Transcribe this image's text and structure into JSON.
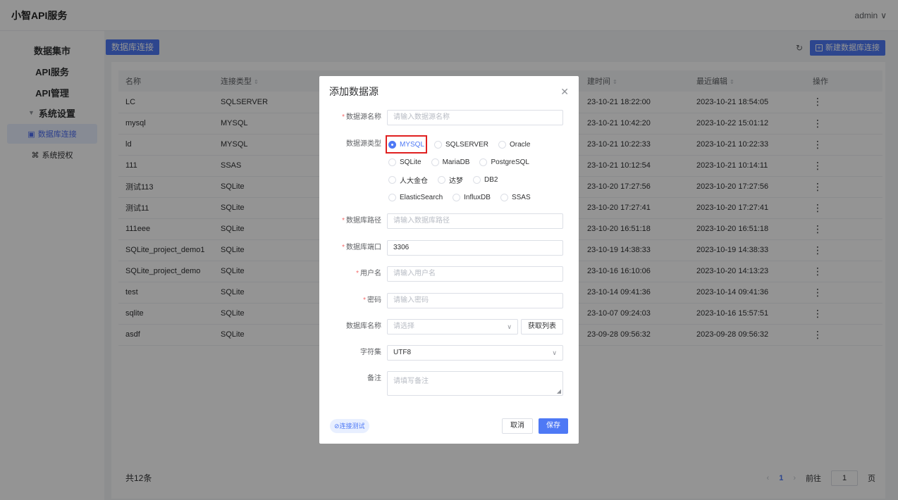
{
  "header": {
    "brand": "小智API服务",
    "user": "admin"
  },
  "sidebar": {
    "items": [
      {
        "label": "数据集市"
      },
      {
        "label": "API服务"
      },
      {
        "label": "API管理"
      }
    ],
    "group": {
      "label": "系统设置",
      "caret": "▼"
    },
    "sub_items": [
      {
        "label": "数据库连接",
        "icon": "▣",
        "active": true
      },
      {
        "label": "系统授权",
        "icon": "⌘",
        "active": false
      }
    ]
  },
  "main": {
    "title_tag": "数据库连接",
    "refresh_icon": "↻",
    "new_button": "新建数据库连接",
    "columns": [
      "名称",
      "连接类型",
      "建时间",
      "最近编辑",
      "操作"
    ],
    "rows": [
      {
        "name": "LC",
        "type": "SQLSERVER",
        "created": "23-10-21 18:22:00",
        "edited": "2023-10-21 18:54:05"
      },
      {
        "name": "mysql",
        "type": "MYSQL",
        "created": "23-10-21 10:42:20",
        "edited": "2023-10-22 15:01:12"
      },
      {
        "name": "ld",
        "type": "MYSQL",
        "created": "23-10-21 10:22:33",
        "edited": "2023-10-21 10:22:33"
      },
      {
        "name": "111",
        "type": "SSAS",
        "created": "23-10-21 10:12:54",
        "edited": "2023-10-21 10:14:11"
      },
      {
        "name": "测试113",
        "type": "SQLite",
        "created": "23-10-20 17:27:56",
        "edited": "2023-10-20 17:27:56"
      },
      {
        "name": "测试11",
        "type": "SQLite",
        "created": "23-10-20 17:27:41",
        "edited": "2023-10-20 17:27:41"
      },
      {
        "name": "111eee",
        "type": "SQLite",
        "created": "23-10-20 16:51:18",
        "edited": "2023-10-20 16:51:18"
      },
      {
        "name": "SQLite_project_demo1",
        "type": "SQLite",
        "created": "23-10-19 14:38:33",
        "edited": "2023-10-19 14:38:33"
      },
      {
        "name": "SQLite_project_demo",
        "type": "SQLite",
        "created": "23-10-16 16:10:06",
        "edited": "2023-10-20 14:13:23"
      },
      {
        "name": "test",
        "type": "SQLite",
        "created": "23-10-14 09:41:36",
        "edited": "2023-10-14 09:41:36"
      },
      {
        "name": "sqlite",
        "type": "SQLite",
        "created": "23-10-07 09:24:03",
        "edited": "2023-10-16 15:57:51"
      },
      {
        "name": "asdf",
        "type": "SQLite",
        "created": "23-09-28 09:56:32",
        "edited": "2023-09-28 09:56:32"
      }
    ],
    "ops_icon": "⋮",
    "total": "共12条",
    "pager": {
      "prev": "‹",
      "current": "1",
      "next": "›",
      "goto": "前往",
      "page_value": "1",
      "page_unit": "页"
    }
  },
  "dialog": {
    "title": "添加数据源",
    "close_icon": "✕",
    "fields": {
      "name": {
        "label": "数据源名称",
        "placeholder": "请输入数据源名称"
      },
      "type": {
        "label": "数据源类型",
        "options": [
          "MYSQL",
          "SQLSERVER",
          "Oracle",
          "SQLite",
          "MariaDB",
          "PostgreSQL",
          "人大金仓",
          "达梦",
          "DB2",
          "ElasticSearch",
          "InfluxDB",
          "SSAS"
        ],
        "selected": "MYSQL"
      },
      "path": {
        "label": "数据库路径",
        "placeholder": "请输入数据库路径"
      },
      "port": {
        "label": "数据库端口",
        "value": "3306"
      },
      "username": {
        "label": "用户名",
        "placeholder": "请输入用户名"
      },
      "password": {
        "label": "密码",
        "placeholder": "请输入密码"
      },
      "dbname": {
        "label": "数据库名称",
        "placeholder": "请选择",
        "fetch_button": "获取列表"
      },
      "charset": {
        "label": "字符集",
        "value": "UTF8"
      },
      "remark": {
        "label": "备注",
        "placeholder": "请填写备注"
      }
    },
    "test_button": "⊘连接测试",
    "cancel_button": "取消",
    "save_button": "保存"
  }
}
